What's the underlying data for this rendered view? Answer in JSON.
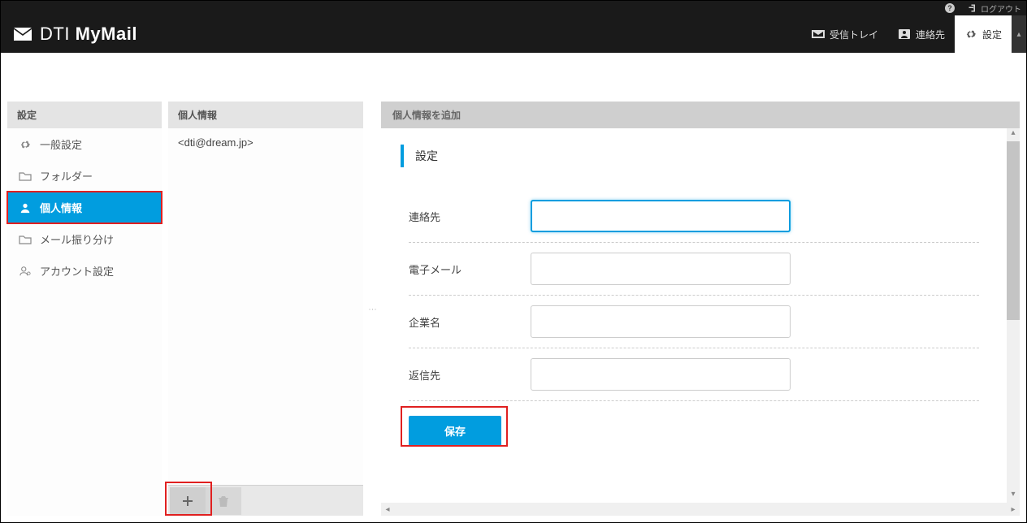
{
  "topbar": {
    "help": "?",
    "user": "",
    "logout": "ログアウト"
  },
  "header": {
    "logo_dti": "DTI",
    "logo_mymail": "MyMail",
    "nav": {
      "inbox": "受信トレイ",
      "contacts": "連絡先",
      "settings": "設定"
    }
  },
  "sidebar": {
    "title": "設定",
    "items": [
      {
        "label": "一般設定"
      },
      {
        "label": "フォルダー"
      },
      {
        "label": "個人情報"
      },
      {
        "label": "メール振り分け"
      },
      {
        "label": "アカウント設定"
      }
    ]
  },
  "identities": {
    "title": "個人情報",
    "entry": "<dti@dream.jp>"
  },
  "main": {
    "title": "個人情報を追加",
    "section": "設定",
    "fields": {
      "contact": {
        "label": "連絡先",
        "value": ""
      },
      "email": {
        "label": "電子メール",
        "value": ""
      },
      "company": {
        "label": "企業名",
        "value": ""
      },
      "replyto": {
        "label": "返信先",
        "value": ""
      }
    },
    "save": "保存"
  }
}
